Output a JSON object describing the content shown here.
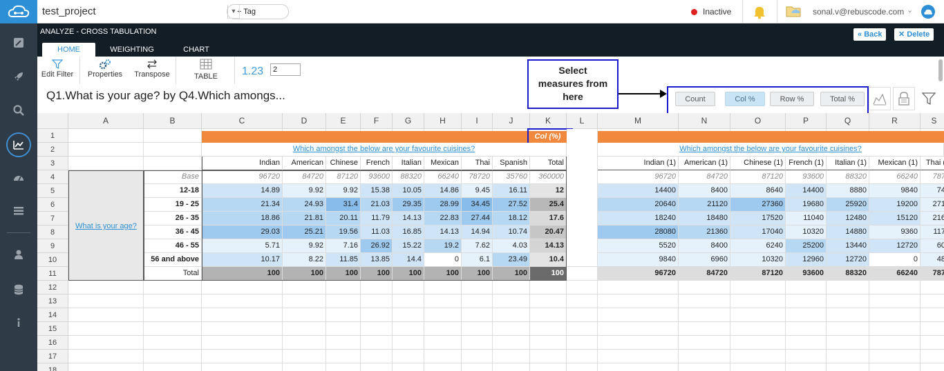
{
  "topbar": {
    "project": "test_project",
    "tag_label": "+ Tag",
    "status": "Inactive",
    "user_email": "sonal.v@rebuscode.com"
  },
  "header": {
    "title": "ANALYZE - CROSS TABULATION",
    "tabs": [
      "HOME",
      "WEIGHTING",
      "CHART"
    ],
    "back_label": "Back",
    "delete_label": "Delete"
  },
  "toolbar": {
    "edit_filter": "Edit Filter",
    "properties": "Properties",
    "transpose": "Transpose",
    "table": "TABLE",
    "decimal_sample": "1.23",
    "decimal_value": "2"
  },
  "question_title": "Q1.What is your age? by Q4.Which amongs...",
  "callout": {
    "line1": "Select",
    "line2": "measures from",
    "line3": "here"
  },
  "measures": [
    "Count",
    "Col %",
    "Row %",
    "Total %"
  ],
  "selected_measure": "Col %",
  "columns": [
    "A",
    "B",
    "C",
    "D",
    "E",
    "F",
    "G",
    "H",
    "I",
    "J",
    "K",
    "L",
    "M",
    "N",
    "O",
    "P",
    "Q",
    "R",
    "S"
  ],
  "rows": [
    "1",
    "2",
    "3",
    "4",
    "5",
    "6",
    "7",
    "8",
    "9",
    "10",
    "11",
    "12",
    "13",
    "14",
    "15",
    "16",
    "17",
    "18"
  ],
  "table1": {
    "header_tag": "Col (%)",
    "banner": "Which amongst the below are your favourite cuisines?",
    "side_label": "What is your age?",
    "col_headers": [
      "Indian",
      "American",
      "Chinese",
      "French",
      "Italian",
      "Mexican",
      "Thai",
      "Spanish",
      "Total"
    ],
    "base_label": "Base",
    "base": [
      "96720",
      "84720",
      "87120",
      "93600",
      "88320",
      "66240",
      "78720",
      "35760",
      "360000"
    ],
    "row_labels": [
      "12-18",
      "19 - 25",
      "26 - 35",
      "36 - 45",
      "46 - 55",
      "56 and above",
      "Total"
    ],
    "data": [
      [
        "14.89",
        "9.92",
        "9.92",
        "15.38",
        "10.05",
        "14.86",
        "9.45",
        "16.11",
        "12"
      ],
      [
        "21.34",
        "24.93",
        "31.4",
        "21.03",
        "29.35",
        "28.99",
        "34.45",
        "27.52",
        "25.4"
      ],
      [
        "18.86",
        "21.81",
        "20.11",
        "11.79",
        "14.13",
        "22.83",
        "27.44",
        "18.12",
        "17.6"
      ],
      [
        "29.03",
        "25.21",
        "19.56",
        "11.03",
        "16.85",
        "14.13",
        "14.94",
        "10.74",
        "20.47"
      ],
      [
        "5.71",
        "9.92",
        "7.16",
        "26.92",
        "15.22",
        "19.2",
        "7.62",
        "4.03",
        "14.13"
      ],
      [
        "10.17",
        "8.22",
        "11.85",
        "13.85",
        "14.4",
        "0",
        "6.1",
        "23.49",
        "10.4"
      ],
      [
        "100",
        "100",
        "100",
        "100",
        "100",
        "100",
        "100",
        "100",
        "100"
      ]
    ]
  },
  "table2": {
    "banner": "Which amongst the below are your favourite cuisines?",
    "col_headers": [
      "Indian (1)",
      "American (1)",
      "Chinese (1)",
      "French (1)",
      "Italian (1)",
      "Mexican (1)",
      "Thai ("
    ],
    "base": [
      "96720",
      "84720",
      "87120",
      "93600",
      "88320",
      "66240",
      "787"
    ],
    "data": [
      [
        "14400",
        "8400",
        "8640",
        "14400",
        "8880",
        "9840",
        "74"
      ],
      [
        "20640",
        "21120",
        "27360",
        "19680",
        "25920",
        "19200",
        "271"
      ],
      [
        "18240",
        "18480",
        "17520",
        "11040",
        "12480",
        "15120",
        "216"
      ],
      [
        "28080",
        "21360",
        "17040",
        "10320",
        "14880",
        "9360",
        "117"
      ],
      [
        "5520",
        "8400",
        "6240",
        "25200",
        "13440",
        "12720",
        "60"
      ],
      [
        "9840",
        "6960",
        "10320",
        "12960",
        "12720",
        "0",
        "48"
      ],
      [
        "96720",
        "84720",
        "87120",
        "93600",
        "88320",
        "66240",
        "787"
      ]
    ]
  }
}
